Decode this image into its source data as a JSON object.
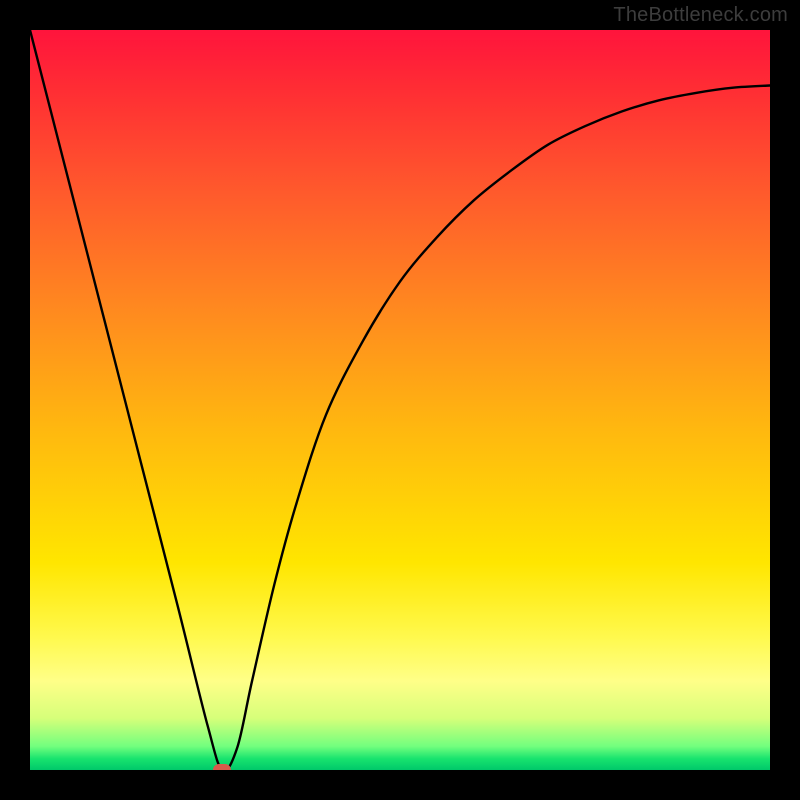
{
  "attribution": "TheBottleneck.com",
  "chart_data": {
    "type": "line",
    "title": "",
    "xlabel": "",
    "ylabel": "",
    "xlim": [
      0,
      100
    ],
    "ylim": [
      0,
      100
    ],
    "series": [
      {
        "name": "bottleneck-curve",
        "x": [
          0,
          5,
          10,
          15,
          20,
          24,
          26,
          28,
          30,
          33,
          36,
          40,
          45,
          50,
          55,
          60,
          65,
          70,
          75,
          80,
          85,
          90,
          95,
          100
        ],
        "y": [
          100,
          80.5,
          61,
          41.5,
          22,
          6,
          0,
          3,
          12,
          25,
          36,
          48,
          58,
          66,
          72,
          77,
          81,
          84.5,
          87,
          89,
          90.5,
          91.5,
          92.2,
          92.5
        ]
      }
    ],
    "marker": {
      "x": 26,
      "y": 0
    },
    "background_gradient": {
      "top": "#ff143c",
      "mid_upper": "#ff8a1f",
      "mid": "#ffe600",
      "mid_lower": "#fff94d",
      "bottom": "#00c86a"
    },
    "frame_color": "#000000",
    "curve_color": "#000000",
    "marker_color": "#d85a4b",
    "attribution_color": "#3d3d3d"
  }
}
